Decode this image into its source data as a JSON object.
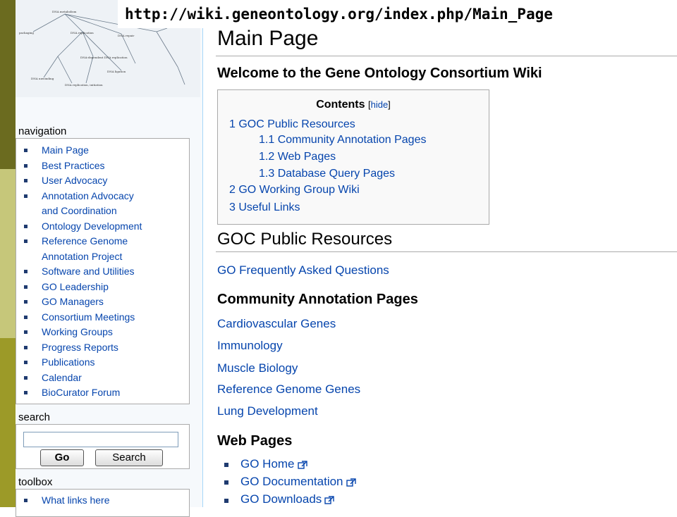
{
  "url": "http://wiki.geneontology.org/index.php/Main_Page",
  "page_title": "Main Page",
  "welcome": "Welcome to the Gene Ontology Consortium Wiki",
  "navigation": {
    "title": "navigation",
    "items": [
      "Main Page",
      "Best Practices",
      "User Advocacy",
      "Annotation Advocacy",
      "and Coordination",
      "Ontology Development",
      "Reference Genome",
      "Annotation Project",
      "Software and Utilities",
      "GO Leadership",
      "GO Managers",
      "Consortium Meetings",
      "Working Groups",
      "Progress Reports",
      "Publications",
      "Calendar",
      "BioCurator Forum"
    ]
  },
  "search": {
    "title": "search",
    "go_label": "Go",
    "search_label": "Search"
  },
  "toolbox": {
    "title": "toolbox",
    "items": [
      "What links here"
    ]
  },
  "toc": {
    "title": "Contents",
    "hide": "hide",
    "items": [
      "1 GOC Public Resources",
      "1.1 Community Annotation Pages",
      "1.2 Web Pages",
      "1.3 Database Query Pages",
      "2 GO Working Group Wiki",
      "3 Useful Links"
    ]
  },
  "section": {
    "heading": "GOC Public Resources",
    "faq_link": "GO Frequently Asked Questions",
    "community_heading": "Community Annotation Pages",
    "community_links": [
      "Cardiovascular Genes",
      "Immunology",
      "Muscle Biology",
      "Reference Genome Genes",
      "Lung Development"
    ],
    "web_heading": "Web Pages",
    "web_links": [
      "GO Home",
      "GO Documentation",
      "GO Downloads"
    ]
  },
  "logo_text": [
    "DNA metabolism",
    "packaging",
    "DNA replication",
    "DNA-dependent DNA replication",
    "DNA ligation",
    "DNA repair",
    "DNA unwinding",
    "DNA replication, initiation"
  ],
  "colors": {
    "link": "#0645ad",
    "strip_dark": "#6b6b1f",
    "strip_light": "#c6c77a",
    "strip_mid": "#9c9a28",
    "bullet": "#1f3b70"
  }
}
